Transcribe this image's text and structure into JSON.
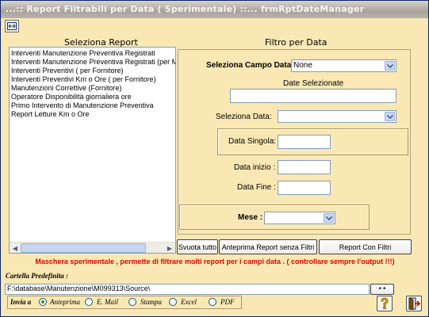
{
  "window": {
    "title": "...:: Report Filtrabili per Data ( Sperimentale) ::...   frmRptDateManager"
  },
  "toolbar": {
    "icon": "resize-icon"
  },
  "report_section": {
    "heading": "Seleziona Report",
    "items": [
      "Interventi Manutenzione Preventiva Registrati",
      "Interventi Manutenzione Preventiva Registrati (per  Matric",
      "Interventi Preventivi  ( per Fornitore)",
      "Interventi Preventivi Km o Ore  ( per Fornitore)",
      "Manutenzioni Correttive (Fornitore)",
      "Operatore Disponibilità giornaliera ore",
      "Primo Intervento di Manutenzione Preventiva",
      "Report Letture Km o Ore"
    ]
  },
  "filter_section": {
    "heading": "Filtro per Data",
    "campo_label": "Seleziona Campo Data :",
    "campo_value": "None",
    "date_selezionate_label": "Date Selezionate",
    "date_selezionate_value": "",
    "seleziona_data_label": "Seleziona Data:",
    "seleziona_data_value": "",
    "data_singola_label": "Data Singola:",
    "data_singola_value": "",
    "data_inizio_label": "Data inizio :",
    "data_inizio_value": "",
    "data_fine_label": "Data Fine :",
    "data_fine_value": "",
    "mese_label": "Mese :",
    "mese_value": ""
  },
  "buttons": {
    "svuota": "Svuota tutto",
    "anteprima_senza": "Anteprima Report senza Filtri",
    "report_con": "Report Con Filtri",
    "dots": "* *"
  },
  "warning": "Maschera sperimentale ,  permette di filtrare molti report per i campi data .  ( controllare sempre l'output !!!)",
  "cartella": {
    "label": "Cartella Predefinita :",
    "path": "F:\\database\\Manutenzione\\M099313\\Source\\"
  },
  "invia": {
    "label": "Invia a",
    "options": [
      {
        "label": "Anteprima",
        "selected": true
      },
      {
        "label": "E. Mail",
        "selected": false
      },
      {
        "label": "Stampa",
        "selected": false
      },
      {
        "label": "Excel",
        "selected": false
      },
      {
        "label": "PDF",
        "selected": false
      }
    ]
  },
  "colors": {
    "background": "#fae8b4",
    "warning": "#e00000",
    "radio_selected": "#21a121"
  }
}
